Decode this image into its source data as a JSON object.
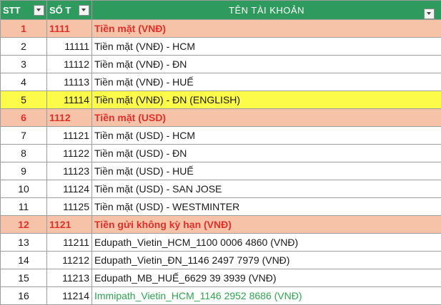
{
  "header": {
    "stt_label": "STT",
    "code_label": "SỐ T",
    "name_label": "TÊN TÀI KHOẢN"
  },
  "colors": {
    "header_bg": "#2e9a5e",
    "group_bg": "#f6c3a9",
    "group_text": "#e0302a",
    "highlight_bg": "#fdfb4a",
    "green_text": "#2fa34f"
  },
  "rows": [
    {
      "stt": "1",
      "code": "1111",
      "name": "Tiền mặt (VNĐ)",
      "style": "group"
    },
    {
      "stt": "2",
      "code": "11111",
      "name": "Tiền mặt (VNĐ) - HCM",
      "style": "normal"
    },
    {
      "stt": "3",
      "code": "11112",
      "name": "Tiền mặt (VNĐ) - ĐN",
      "style": "normal"
    },
    {
      "stt": "4",
      "code": "11113",
      "name": "Tiền mặt (VNĐ) - HUẾ",
      "style": "normal"
    },
    {
      "stt": "5",
      "code": "11114",
      "name": "Tiền mặt (VNĐ) - ĐN (ENGLISH)",
      "style": "highlight"
    },
    {
      "stt": "6",
      "code": "1112",
      "name": "Tiền mặt (USD)",
      "style": "group"
    },
    {
      "stt": "7",
      "code": "11121",
      "name": "Tiền mặt (USD) - HCM",
      "style": "normal"
    },
    {
      "stt": "8",
      "code": "11122",
      "name": "Tiền mặt (USD) - ĐN",
      "style": "normal"
    },
    {
      "stt": "9",
      "code": "11123",
      "name": "Tiền mặt (USD) - HUẾ",
      "style": "normal"
    },
    {
      "stt": "10",
      "code": "11124",
      "name": "Tiền mặt (USD) - SAN JOSE",
      "style": "normal"
    },
    {
      "stt": "11",
      "code": "11125",
      "name": "Tiền mặt (USD) - WESTMINTER",
      "style": "normal"
    },
    {
      "stt": "12",
      "code": "1121",
      "name": "Tiền gửi không kỳ hạn (VNĐ)",
      "style": "group"
    },
    {
      "stt": "13",
      "code": "11211",
      "name": "Edupath_Vietin_HCM_1100 0006 4860 (VNĐ)",
      "style": "normal"
    },
    {
      "stt": "14",
      "code": "11212",
      "name": "Edupath_Vietin_ĐN_1146 2497 7979 (VNĐ)",
      "style": "normal"
    },
    {
      "stt": "15",
      "code": "11213",
      "name": "Edupath_MB_HUẾ_6629 39 3939 (VNĐ)",
      "style": "normal"
    },
    {
      "stt": "16",
      "code": "11214",
      "name": "Immipath_Vietin_HCM_1146 2952 8686 (VNĐ)",
      "style": "green"
    }
  ]
}
